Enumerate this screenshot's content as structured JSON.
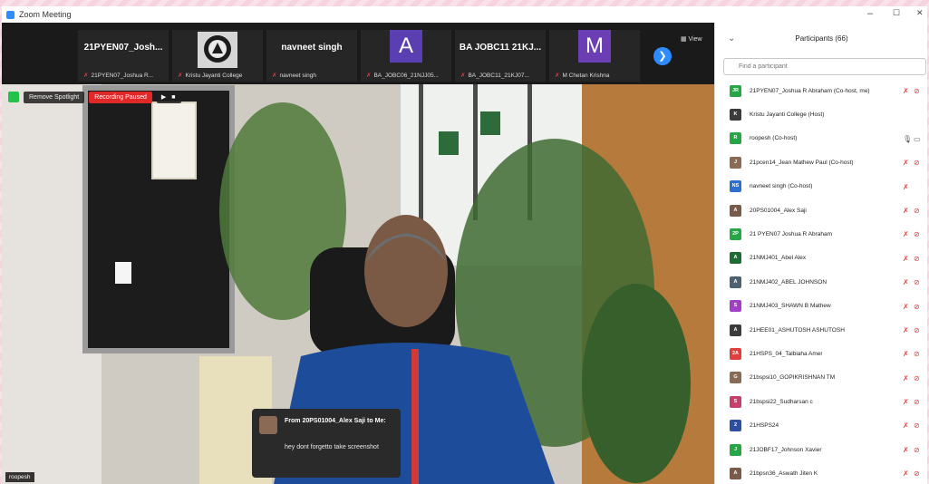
{
  "window": {
    "title": "Zoom Meeting",
    "min_glyph": "–",
    "max_glyph": "☐",
    "close_glyph": "✕"
  },
  "strip": {
    "tiles": [
      {
        "name": "21PYEN07_Josh...",
        "caption": "21PYEN07_Joshua R...",
        "letter": "",
        "color": "#262626"
      },
      {
        "name": "",
        "caption": "Kristu Jayanti College",
        "letter": "",
        "color": "#262626",
        "logo": true
      },
      {
        "name": "navneet singh",
        "caption": "navneet singh",
        "letter": "",
        "color": "#262626"
      },
      {
        "name": "",
        "caption": "BA_JOBC06_21NJJ05...",
        "letter": "A",
        "color": "#5a3fb3"
      },
      {
        "name": "BA JOBC11 21KJ...",
        "caption": "BA_JOBC11_21KJ07...",
        "letter": "",
        "color": "#262626"
      },
      {
        "name": "",
        "caption": "M Chetan Krishna",
        "letter": "M",
        "color": "#6b3fb3"
      }
    ],
    "next_glyph": "❯",
    "view_label": "▦ View"
  },
  "stage": {
    "remove_spotlight": "Remove Spotlight",
    "recording_status": "Recording Paused",
    "recording_controls": "▶ ■",
    "speaker_name": "roopesh",
    "chat": {
      "from": "From 20PS01004_Alex Saji to Me:",
      "message": "hey dont forgetto take screenshot"
    }
  },
  "panel": {
    "title": "Participants (66)",
    "search_placeholder": "Find a participant",
    "participants": [
      {
        "name": "21PYEN07_Joshua R Abraham (Co-host, me)",
        "initials": "JR",
        "color": "#26a645",
        "mic": "muted",
        "cam": "off"
      },
      {
        "name": "Kristu Jayanti College (Host)",
        "initials": "K",
        "color": "#3b3b3b",
        "mic": "none",
        "cam": "none"
      },
      {
        "name": "roopesh (Co-host)",
        "initials": "R",
        "color": "#26a645",
        "mic": "on",
        "cam": "on"
      },
      {
        "name": "21pcen14_Jean Mathew Paul (Co-host)",
        "initials": "J",
        "color": "#8a6a55",
        "mic": "muted",
        "cam": "off"
      },
      {
        "name": "navneet singh (Co-host)",
        "initials": "NS",
        "color": "#2d6fd1",
        "mic": "muted",
        "cam": "none"
      },
      {
        "name": "20PS01004_Alex Saji",
        "initials": "A",
        "color": "#7a5a48",
        "mic": "muted",
        "cam": "off"
      },
      {
        "name": "21 PYEN07 Joshua R Abraham",
        "initials": "2P",
        "color": "#26a645",
        "mic": "muted",
        "cam": "off"
      },
      {
        "name": "21NMJ401_Abel Alex",
        "initials": "A",
        "color": "#1e6b33",
        "mic": "muted",
        "cam": "off"
      },
      {
        "name": "21NMJ402_ABEL JOHNSON",
        "initials": "A",
        "color": "#4a6272",
        "mic": "muted",
        "cam": "off"
      },
      {
        "name": "21NMJ403_SHAWN B Mathew",
        "initials": "S",
        "color": "#a13fc8",
        "mic": "muted",
        "cam": "off"
      },
      {
        "name": "21HEE01_ASHUTOSH ASHUTOSH",
        "initials": "A",
        "color": "#3b3b3b",
        "mic": "muted",
        "cam": "off"
      },
      {
        "name": "21HSPS_04_Talbiaha Amer",
        "initials": "2A",
        "color": "#e0403b",
        "mic": "muted",
        "cam": "off"
      },
      {
        "name": "21bspsi10_GOPIKRISHNAN TM",
        "initials": "G",
        "color": "#8a6a55",
        "mic": "muted",
        "cam": "off"
      },
      {
        "name": "21bspsi22_Sudharsan c",
        "initials": "S",
        "color": "#c83f6b",
        "mic": "muted",
        "cam": "off"
      },
      {
        "name": "21HSPS24",
        "initials": "2",
        "color": "#2d4fa1",
        "mic": "muted",
        "cam": "off"
      },
      {
        "name": "21JOBF17_Johnson Xavier",
        "initials": "J",
        "color": "#26a645",
        "mic": "muted",
        "cam": "off"
      },
      {
        "name": "21bpsn36_Aswath Jiten K",
        "initials": "A",
        "color": "#7a5a48",
        "mic": "muted",
        "cam": "off"
      }
    ]
  },
  "icons": {
    "mic_muted": "mic-muted-icon",
    "mic_on": "mic-icon",
    "cam_off": "camera-off-icon",
    "cam_on": "camera-icon",
    "search": "search-icon"
  }
}
